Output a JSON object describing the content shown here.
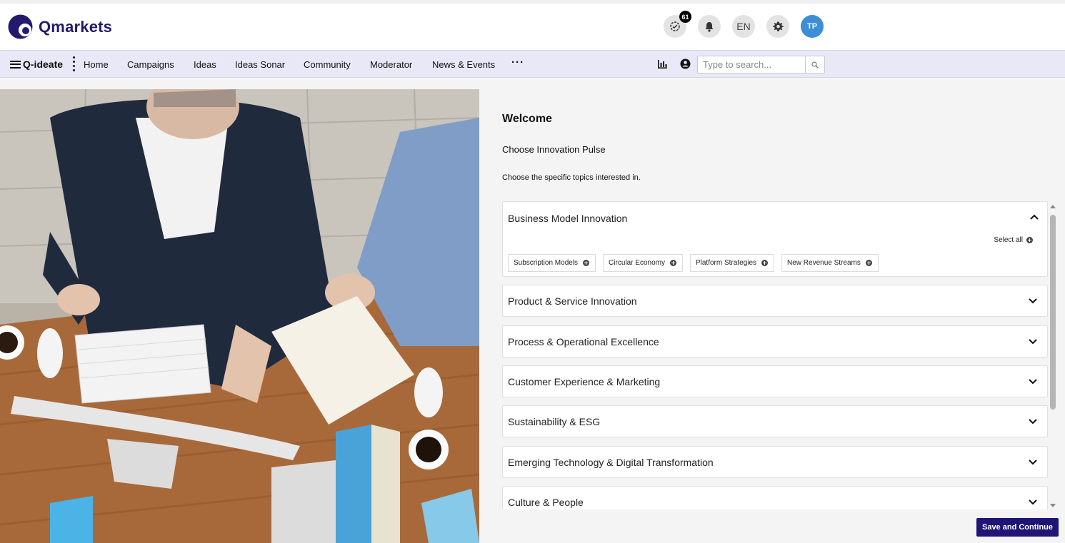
{
  "app": {
    "brand_name": "Qmarkets",
    "brand_color": "#241a6d",
    "accent": "#1e1575"
  },
  "header": {
    "activity_badge": "61",
    "language": "EN",
    "avatar_initials": "TP"
  },
  "nav": {
    "brand": "Q-ideate",
    "items": [
      "Home",
      "Campaigns",
      "Ideas",
      "Ideas Sonar",
      "Community",
      "Moderator",
      "News & Events"
    ],
    "more": "···",
    "search_placeholder": "Type to search..."
  },
  "welcome": {
    "title": "Welcome",
    "pulse": "Choose Innovation Pulse",
    "instructions": "Choose the specific topics interested in."
  },
  "categories": [
    {
      "title": "Business Model Innovation",
      "expanded": true,
      "select_all": "Select all",
      "topics": [
        "Subscription Models",
        "Circular Economy",
        "Platform Strategies",
        "New Revenue Streams"
      ]
    },
    {
      "title": "Product & Service Innovation",
      "expanded": false
    },
    {
      "title": "Process & Operational Excellence",
      "expanded": false
    },
    {
      "title": "Customer Experience & Marketing",
      "expanded": false
    },
    {
      "title": "Sustainability & ESG",
      "expanded": false
    },
    {
      "title": "Emerging Technology & Digital Transformation",
      "expanded": false
    },
    {
      "title": "Culture & People",
      "expanded": false
    }
  ],
  "actions": {
    "save": "Save and Continue"
  }
}
